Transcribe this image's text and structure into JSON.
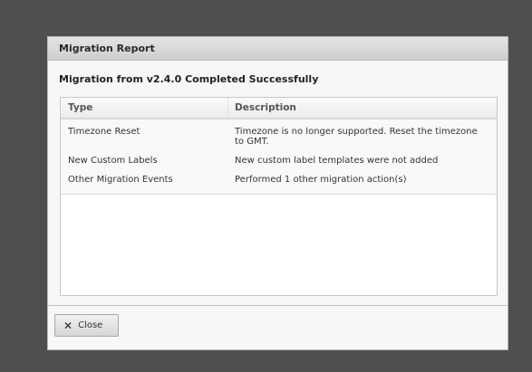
{
  "dialog": {
    "title": "Migration Report",
    "heading": "Migration from v2.4.0 Completed Successfully"
  },
  "table": {
    "columns": [
      "Type",
      "Description"
    ],
    "rows": [
      {
        "type": "Timezone Reset",
        "description": "Timezone is no longer supported. Reset the timezone to GMT."
      },
      {
        "type": "New Custom Labels",
        "description": "New custom label templates were not added"
      },
      {
        "type": "Other Migration Events",
        "description": "Performed 1 other migration action(s)"
      }
    ]
  },
  "footer": {
    "close_icon": "close-x-icon",
    "close_label": "Close"
  }
}
